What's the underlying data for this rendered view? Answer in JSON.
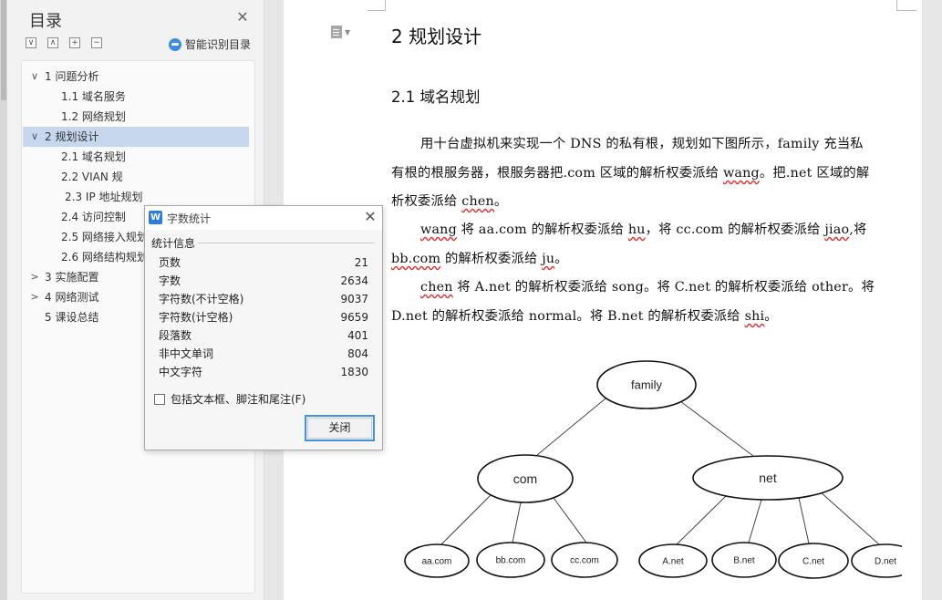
{
  "toc": {
    "title": "目录",
    "smart_label": "智能识别目录",
    "tools": [
      "∨",
      "∧",
      "+",
      "−"
    ],
    "items": [
      {
        "label": "1  问题分析",
        "chev": "∨"
      },
      {
        "label": "1.1 域名服务",
        "chev": ""
      },
      {
        "label": "1.2 网络规划",
        "chev": ""
      },
      {
        "label": "2  规划设计",
        "chev": "∨",
        "selected": true
      },
      {
        "label": "2.1 域名规划",
        "chev": ""
      },
      {
        "label": "2.2 VIAN 规",
        "chev": ""
      },
      {
        "label": "2.3 IP 地址规划",
        "chev": ""
      },
      {
        "label": "2.4  访问控制",
        "chev": ""
      },
      {
        "label": "2.5  网络接入规划",
        "chev": ""
      },
      {
        "label": "2.6  网络结构规划",
        "chev": ""
      },
      {
        "label": "3  实施配置",
        "chev": ">"
      },
      {
        "label": "4 网络测试",
        "chev": ">"
      },
      {
        "label": "5  课设总结",
        "chev": ""
      }
    ]
  },
  "document": {
    "heading1": "2  规划设计",
    "heading2": "2.1 域名规划",
    "paragraphs": [
      [
        {
          "t": "用十台虚拟机来实现一个 DNS 的私有根，规划如下图所示，family 充当私"
        }
      ],
      [
        {
          "t": "有根的根服务器，根服务器把.com 区域的解析权委派给 "
        },
        {
          "t": "wang",
          "w": true
        },
        {
          "t": "。把.net 区域的解"
        }
      ],
      [
        {
          "t": "析权委派给 "
        },
        {
          "t": "chen",
          "w": true
        },
        {
          "t": "。"
        }
      ],
      [
        {
          "t": "wang",
          "w": true
        },
        {
          "t": " 将 aa.com 的解析权委派给 "
        },
        {
          "t": "hu",
          "w": true
        },
        {
          "t": "，将 cc.com 的解析权委派给 "
        },
        {
          "t": "jiao",
          "w": true
        },
        {
          "t": ",将"
        }
      ],
      [
        {
          "t": "bb.com",
          "w": true
        },
        {
          "t": " 的解析权委派给 "
        },
        {
          "t": "ju",
          "w": true
        },
        {
          "t": "。"
        }
      ],
      [
        {
          "t": "chen",
          "w": true
        },
        {
          "t": " 将 A.net 的解析权委派给 song。将 C.net 的解析权委派给 other。将"
        }
      ],
      [
        {
          "t": "D.net 的解析权委派给 normal。将 B.net 的解析权委派给 "
        },
        {
          "t": "shi",
          "w": true
        },
        {
          "t": "。"
        }
      ]
    ],
    "diagram": {
      "root": "family",
      "mid": [
        "com",
        "net"
      ],
      "leaves_com": [
        "aa.com",
        "bb.com",
        "cc.com"
      ],
      "leaves_net": [
        "A.net",
        "B.net",
        "C.net",
        "D.net"
      ]
    }
  },
  "dialog": {
    "title": "字数统计",
    "logo": "W",
    "group_label": "统计信息",
    "stats": [
      {
        "k": "页数",
        "v": "21"
      },
      {
        "k": "字数",
        "v": "2634"
      },
      {
        "k": "字符数(不计空格)",
        "v": "9037"
      },
      {
        "k": "字符数(计空格)",
        "v": "9659"
      },
      {
        "k": "段落数",
        "v": "401"
      },
      {
        "k": "非中文单词",
        "v": "804"
      },
      {
        "k": "中文字符",
        "v": "1830"
      }
    ],
    "checkbox_label": "包括文本框、脚注和尾注(F)",
    "close_button": "关闭"
  }
}
